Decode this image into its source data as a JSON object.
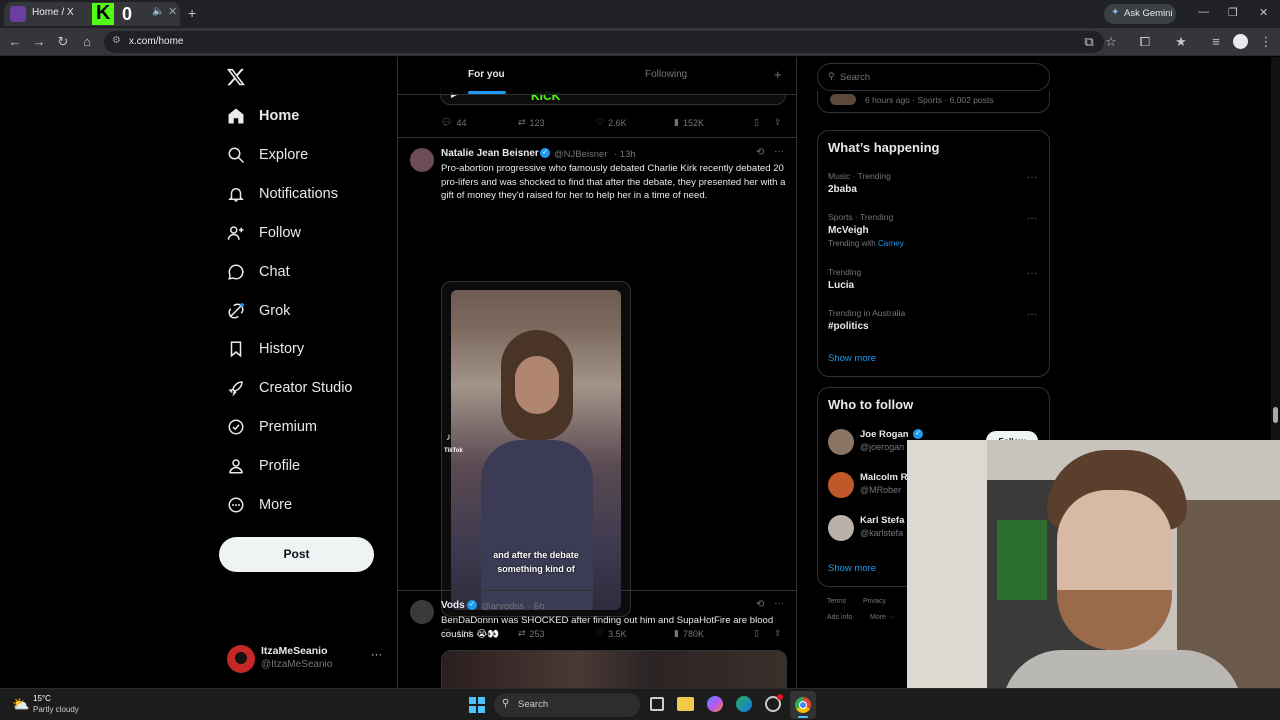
{
  "browser": {
    "tab_title": "Home / X",
    "address": "x.com/home",
    "ask_gemini": "Ask Gemini"
  },
  "nav": {
    "items": [
      {
        "label": "Home",
        "icon": "home-icon"
      },
      {
        "label": "Explore",
        "icon": "search-icon"
      },
      {
        "label": "Notifications",
        "icon": "bell-icon"
      },
      {
        "label": "Follow",
        "icon": "person-add-icon"
      },
      {
        "label": "Chat",
        "icon": "chat-icon"
      },
      {
        "label": "Grok",
        "icon": "grok-icon"
      },
      {
        "label": "History",
        "icon": "bookmark-icon"
      },
      {
        "label": "Creator Studio",
        "icon": "rocket-icon"
      },
      {
        "label": "Premium",
        "icon": "verified-icon"
      },
      {
        "label": "Profile",
        "icon": "person-icon"
      },
      {
        "label": "More",
        "icon": "more-circle-icon"
      }
    ],
    "post_button": "Post",
    "account": {
      "name": "ItzaMeSeanio",
      "handle": "@ItzaMeSeanio"
    }
  },
  "feed": {
    "tabs": [
      "For you",
      "Following"
    ],
    "prev_stats": {
      "replies": "44",
      "reposts": "123",
      "likes": "2.6K",
      "views": "152K"
    },
    "tweet1": {
      "name": "Natalie Jean Beisner",
      "handle": "@NJBeisner",
      "time": "· 13h",
      "text": "Pro-abortion progressive who famously debated Charlie Kirk recently debated 20 pro-lifers and was shocked to find that after the debate, they presented her with a gift of money they'd raised for her to help her in a time of need.",
      "caption_line1": "and after the debate",
      "caption_line2": "something kind of",
      "tiktok": "TikTok",
      "stats": {
        "replies": "124",
        "reposts": "253",
        "likes": "3.5K",
        "views": "780K"
      }
    },
    "tweet2": {
      "name": "Vods",
      "handle": "@arvodss",
      "time": "· 6h",
      "text": "BenDaDonnn was SHOCKED after finding out him and SupaHotFire are blood cousins 😭👀"
    }
  },
  "sidebar": {
    "search_placeholder": "Search",
    "top_meta": "6 hours ago · Sports · 6,002 posts",
    "whats_happening": "What’s happening",
    "trends": [
      {
        "meta": "Music · Trending",
        "name": "2baba",
        "extra": ""
      },
      {
        "meta": "Sports · Trending",
        "name": "McVeigh",
        "extra": "Trending with",
        "extra_link": "Carney"
      },
      {
        "meta": "Trending",
        "name": "Lucia",
        "extra": ""
      },
      {
        "meta": "Trending in Australia",
        "name": "#politics",
        "extra": ""
      }
    ],
    "show_more": "Show more",
    "who_to_follow": "Who to follow",
    "follow_suggestions": [
      {
        "name": "Joe Rogan",
        "handle": "@joerogan"
      },
      {
        "name": "Malcolm R",
        "handle": "@MRober"
      },
      {
        "name": "Karl Stefa",
        "handle": "@karlstefa"
      }
    ],
    "follow_button": "Follow",
    "show_more_2": "Show more",
    "footer": [
      "Terms",
      "Privacy",
      "Ads info",
      "More ···"
    ]
  },
  "taskbar": {
    "temperature": "15°C",
    "weather": "Partly cloudy",
    "search": "Search"
  },
  "colors": {
    "accent": "#1d9bf0",
    "background": "#000000",
    "border": "#2f3336",
    "muted": "#71767b"
  }
}
